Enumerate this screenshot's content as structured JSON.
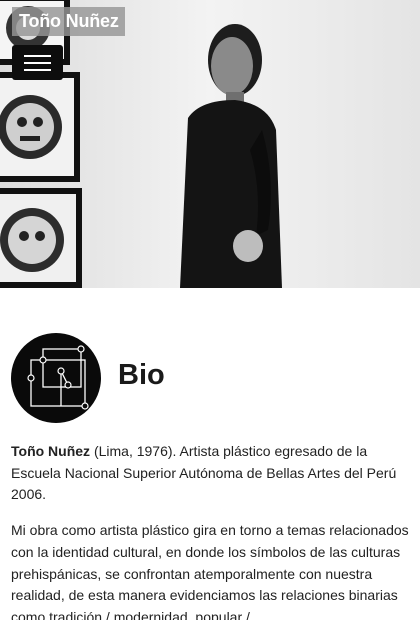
{
  "brand": {
    "name": "Toño Nuñez"
  },
  "nav": {
    "menu_label": "Menu"
  },
  "hero": {
    "alt": "Toño Nuñez portrait"
  },
  "bio": {
    "title": "Bio",
    "paragraph1_name": "Toño Nuñez",
    "paragraph1_rest": " (Lima, 1976). Artista plástico egresado de la Escuela Nacional Superior Autónoma de Bellas Artes del Perú 2006.",
    "paragraph2": "Mi obra como artista plástico gira en torno a temas relacionados con la identidad cultural,  en donde los símbolos de las culturas prehispánicas, se confrontan atemporalmente con nuestra realidad, de esta manera evidenciamos las relaciones binarias como tradición / modernidad, popular /"
  }
}
